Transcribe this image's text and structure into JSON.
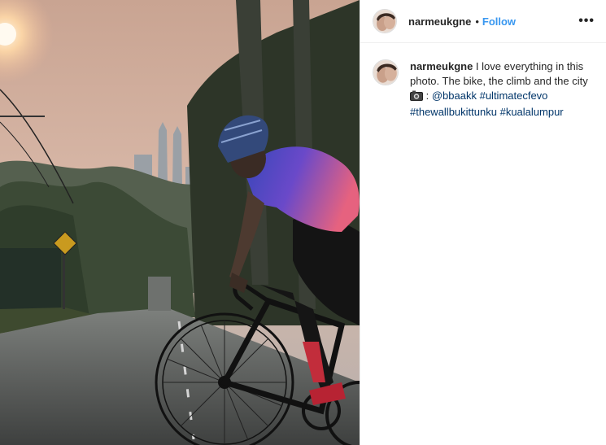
{
  "post": {
    "username": "narmeukgne",
    "dot": "•",
    "follow_label": "Follow",
    "more_label": "•••"
  },
  "caption": {
    "username": "narmeukgne",
    "text_1": " I love everything in this photo. The bike, the climb and the city ",
    "text_2": " : ",
    "mention": "@bbaakk",
    "hashtags": [
      "#ultimatecfevo",
      "#thewallbukittunku",
      "#kualalumpur"
    ],
    "camera_icon": "camera-emoji-icon"
  },
  "colors": {
    "follow": "#3897f0",
    "link": "#003569",
    "text": "#262626",
    "border": "#efefef"
  }
}
